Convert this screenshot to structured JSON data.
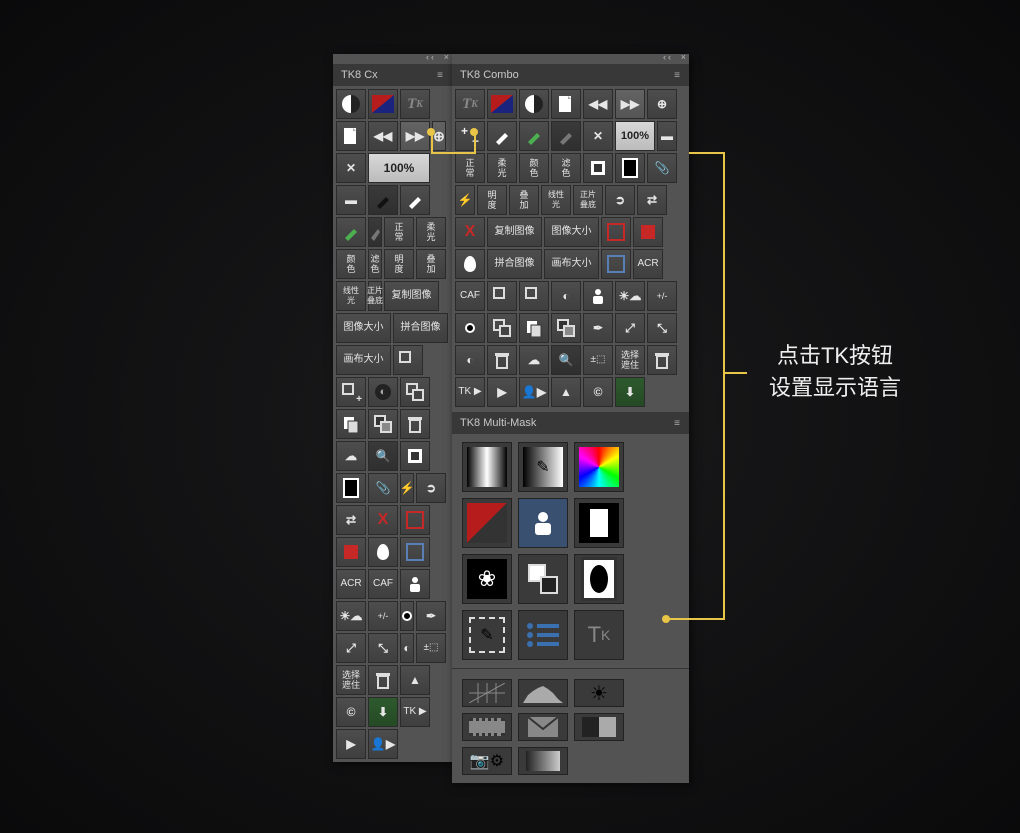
{
  "panels": {
    "cx": {
      "title": "TK8 Cx"
    },
    "combo": {
      "title": "TK8 Combo"
    },
    "multimask": {
      "title": "TK8 Multi-Mask"
    }
  },
  "labels": {
    "pct100": "100%",
    "zhengchang": "正\n常",
    "rouguang": "柔\n光",
    "yanse": "颜\n色",
    "lvse": "滤\n色",
    "mingdu": "明\n度",
    "diejia": "叠\n加",
    "xianxingguang": "线性\n光",
    "zhengpian": "正片\n叠底",
    "fuzhi": "复制图像",
    "tuxiang": "图像大小",
    "pinhe": "拼合图像",
    "huabu": "画布大小",
    "acr": "ACR",
    "caf": "CAF",
    "pm": "+/-",
    "pmcrop": "±⬚",
    "xuanze": "选择\n遮住",
    "tkplay": "TK ▶"
  },
  "annotation": {
    "line1": "点击TK按钮",
    "line2": "设置显示语言"
  }
}
